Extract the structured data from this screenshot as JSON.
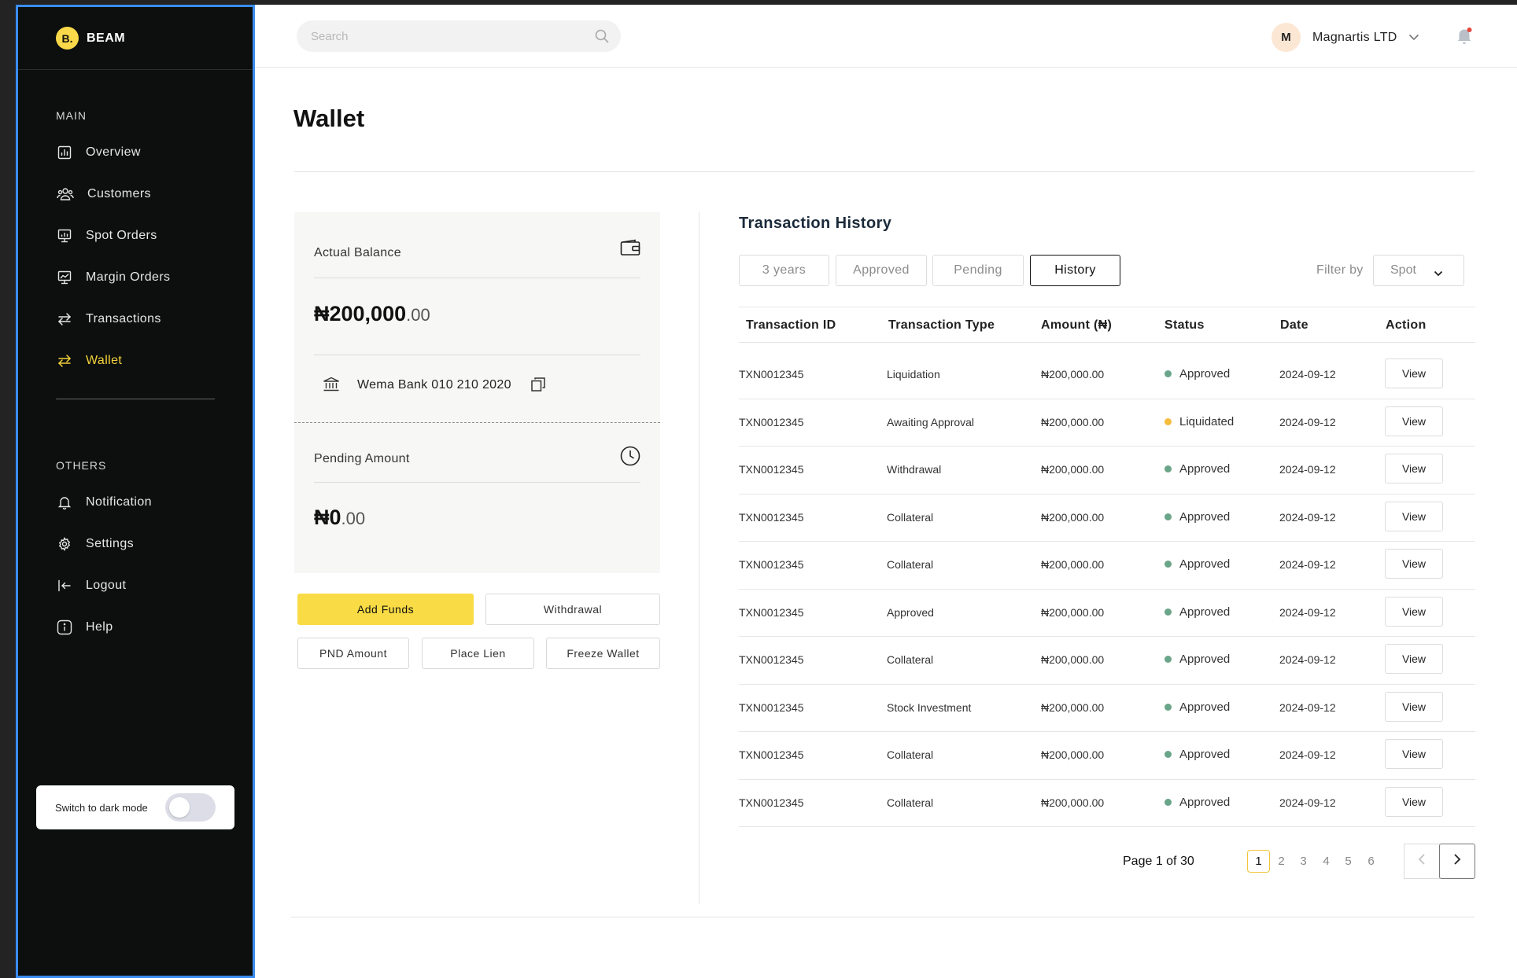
{
  "brand": {
    "logo": "B.",
    "name": "BEAM"
  },
  "sidebar": {
    "main_label": "MAIN",
    "main_items": [
      {
        "label": "Overview",
        "icon": "chart-icon"
      },
      {
        "label": "Customers",
        "icon": "users-icon"
      },
      {
        "label": "Spot Orders",
        "icon": "presentation-icon"
      },
      {
        "label": "Margin Orders",
        "icon": "trend-board-icon"
      },
      {
        "label": "Transactions",
        "icon": "transfer-icon"
      },
      {
        "label": "Wallet",
        "icon": "transfer-icon",
        "active": true
      }
    ],
    "others_label": "OTHERS",
    "other_items": [
      {
        "label": "Notification",
        "icon": "bell-icon"
      },
      {
        "label": "Settings",
        "icon": "gear-icon"
      },
      {
        "label": "Logout",
        "icon": "logout-icon"
      },
      {
        "label": "Help",
        "icon": "info-icon"
      }
    ],
    "dark_mode_label": "Switch to dark mode",
    "dark_mode_on": false
  },
  "header": {
    "search_placeholder": "Search",
    "avatar_initial": "M",
    "account_name": "Magnartis LTD",
    "notification_dot_color": "#e5483e"
  },
  "page": {
    "title": "Wallet"
  },
  "wallet": {
    "actual_balance_label": "Actual Balance",
    "actual_balance_main": "₦200,000",
    "actual_balance_cents": ".00",
    "bank_info": "Wema Bank 010 210 2020",
    "pending_label": "Pending Amount",
    "pending_main": "₦0",
    "pending_cents": ".00",
    "buttons": {
      "add_funds": "Add Funds",
      "withdrawal": "Withdrawal",
      "pnd_amount": "PND Amount",
      "place_lien": "Place Lien",
      "freeze_wallet": "Freeze Wallet"
    },
    "accent_color": "#f9dc45"
  },
  "transactions": {
    "title": "Transaction History",
    "tabs": [
      "3 years",
      "Approved",
      "Pending",
      "History"
    ],
    "active_tab": "History",
    "filter_label": "Filter by",
    "filter_value": "Spot",
    "columns": [
      "Transaction ID",
      "Transaction Type",
      "Amount (₦)",
      "Status",
      "Date",
      "Action"
    ],
    "rows": [
      {
        "id": "TXN0012345",
        "type": "Liquidation",
        "amount": "₦200,000.00",
        "status": "Approved",
        "status_color": "#6aa58a",
        "date": "2024-09-12",
        "action": "View"
      },
      {
        "id": "TXN0012345",
        "type": "Awaiting Approval",
        "amount": "₦200,000.00",
        "status": "Liquidated",
        "status_color": "#f5bd3c",
        "date": "2024-09-12",
        "action": "View"
      },
      {
        "id": "TXN0012345",
        "type": "Withdrawal",
        "amount": "₦200,000.00",
        "status": "Approved",
        "status_color": "#6aa58a",
        "date": "2024-09-12",
        "action": "View"
      },
      {
        "id": "TXN0012345",
        "type": "Collateral",
        "amount": "₦200,000.00",
        "status": "Approved",
        "status_color": "#6aa58a",
        "date": "2024-09-12",
        "action": "View"
      },
      {
        "id": "TXN0012345",
        "type": "Collateral",
        "amount": "₦200,000.00",
        "status": "Approved",
        "status_color": "#6aa58a",
        "date": "2024-09-12",
        "action": "View"
      },
      {
        "id": "TXN0012345",
        "type": "Approved",
        "amount": "₦200,000.00",
        "status": "Approved",
        "status_color": "#6aa58a",
        "date": "2024-09-12",
        "action": "View"
      },
      {
        "id": "TXN0012345",
        "type": "Collateral",
        "amount": "₦200,000.00",
        "status": "Approved",
        "status_color": "#6aa58a",
        "date": "2024-09-12",
        "action": "View"
      },
      {
        "id": "TXN0012345",
        "type": "Stock Investment",
        "amount": "₦200,000.00",
        "status": "Approved",
        "status_color": "#6aa58a",
        "date": "2024-09-12",
        "action": "View"
      },
      {
        "id": "TXN0012345",
        "type": "Collateral",
        "amount": "₦200,000.00",
        "status": "Approved",
        "status_color": "#6aa58a",
        "date": "2024-09-12",
        "action": "View"
      },
      {
        "id": "TXN0012345",
        "type": "Collateral",
        "amount": "₦200,000.00",
        "status": "Approved",
        "status_color": "#6aa58a",
        "date": "2024-09-12",
        "action": "View"
      }
    ],
    "pagination": {
      "label": "Page 1 of 30",
      "pages": [
        "1",
        "2",
        "3",
        "4",
        "5",
        "6"
      ],
      "current": "1"
    }
  }
}
